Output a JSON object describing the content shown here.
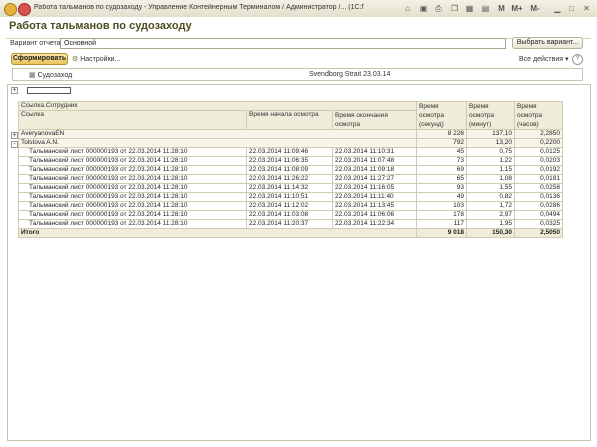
{
  "window": {
    "title": "Работа тальманов по судозаходу - Управление Контейнерным Терминалом / Администратор /... (1С:Предприятие)",
    "toolbar_right": [
      "M",
      "M+",
      "M-"
    ]
  },
  "page": {
    "title": "Работа тальманов по судозаходу"
  },
  "form": {
    "variant_label": "Вариант отчета:",
    "variant_value": "Основной",
    "choose_variant_button": "Выбрать вариант...",
    "generate_button": "Сформировать",
    "settings_button": "Настройки...",
    "all_actions_label": "Все действия",
    "help_button": "?"
  },
  "settings": {
    "param_label": "Судозаход",
    "param_value": "Svendborg Strait 23.03.14"
  },
  "report": {
    "header": {
      "group_col": "Ссылка.Сотрудник",
      "link_col": "Ссылка",
      "start_col": "Время начала осмотра",
      "end_col": "Время окончания осмотра",
      "sec_col": "Время осмотра (секунд)",
      "min_col": "Время осмотра (минут)",
      "hour_col": "Время осмотра (часов)"
    },
    "groups": [
      {
        "name": "AveryanovaEN",
        "sec": "8 226",
        "min": "137,10",
        "hours": "2,2850",
        "expander": "+"
      },
      {
        "name": "Tolstova A.N.",
        "sec": "792",
        "min": "13,20",
        "hours": "0,2200",
        "expander": "-"
      }
    ],
    "rows": [
      {
        "link": "Тальманский лист 000000193 от 22.03.2014 11:28:10",
        "start": "22.03.2014 11:09:46",
        "end": "22.03.2014 11:10:31",
        "sec": "45",
        "min": "0,75",
        "hours": "0,0125"
      },
      {
        "link": "Тальманский лист 000000193 от 22.03.2014 11:28:10",
        "start": "22.03.2014 11:06:35",
        "end": "22.03.2014 11:07:48",
        "sec": "73",
        "min": "1,22",
        "hours": "0,0203"
      },
      {
        "link": "Тальманский лист 000000193 от 22.03.2014 11:28:10",
        "start": "22.03.2014 11:08:09",
        "end": "22.03.2014 11:09:18",
        "sec": "69",
        "min": "1,15",
        "hours": "0,0192"
      },
      {
        "link": "Тальманский лист 000000193 от 22.03.2014 11:28:10",
        "start": "22.03.2014 11:26:22",
        "end": "22.03.2014 11:27:27",
        "sec": "65",
        "min": "1,08",
        "hours": "0,0181"
      },
      {
        "link": "Тальманский лист 000000193 от 22.03.2014 11:28:10",
        "start": "22.03.2014 11:14:32",
        "end": "22.03.2014 11:16:05",
        "sec": "93",
        "min": "1,55",
        "hours": "0,0258"
      },
      {
        "link": "Тальманский лист 000000193 от 22.03.2014 11:28:10",
        "start": "22.03.2014 11:10:51",
        "end": "22.03.2014 11:11:40",
        "sec": "49",
        "min": "0,82",
        "hours": "0,0136"
      },
      {
        "link": "Тальманский лист 000000193 от 22.03.2014 11:28:10",
        "start": "22.03.2014 11:12:02",
        "end": "22.03.2014 11:13:45",
        "sec": "103",
        "min": "1,72",
        "hours": "0,0286"
      },
      {
        "link": "Тальманский лист 000000193 от 22.03.2014 11:28:10",
        "start": "22.03.2014 11:03:08",
        "end": "22.03.2014 11:06:06",
        "sec": "178",
        "min": "2,97",
        "hours": "0,0494"
      },
      {
        "link": "Тальманский лист 000000193 от 22.03.2014 11:28:10",
        "start": "22.03.2014 11:20:37",
        "end": "22.03.2014 11:22:34",
        "sec": "117",
        "min": "1,95",
        "hours": "0,0325"
      }
    ],
    "total": {
      "label": "Итого",
      "sec": "9 018",
      "min": "150,30",
      "hours": "2,5050"
    }
  }
}
